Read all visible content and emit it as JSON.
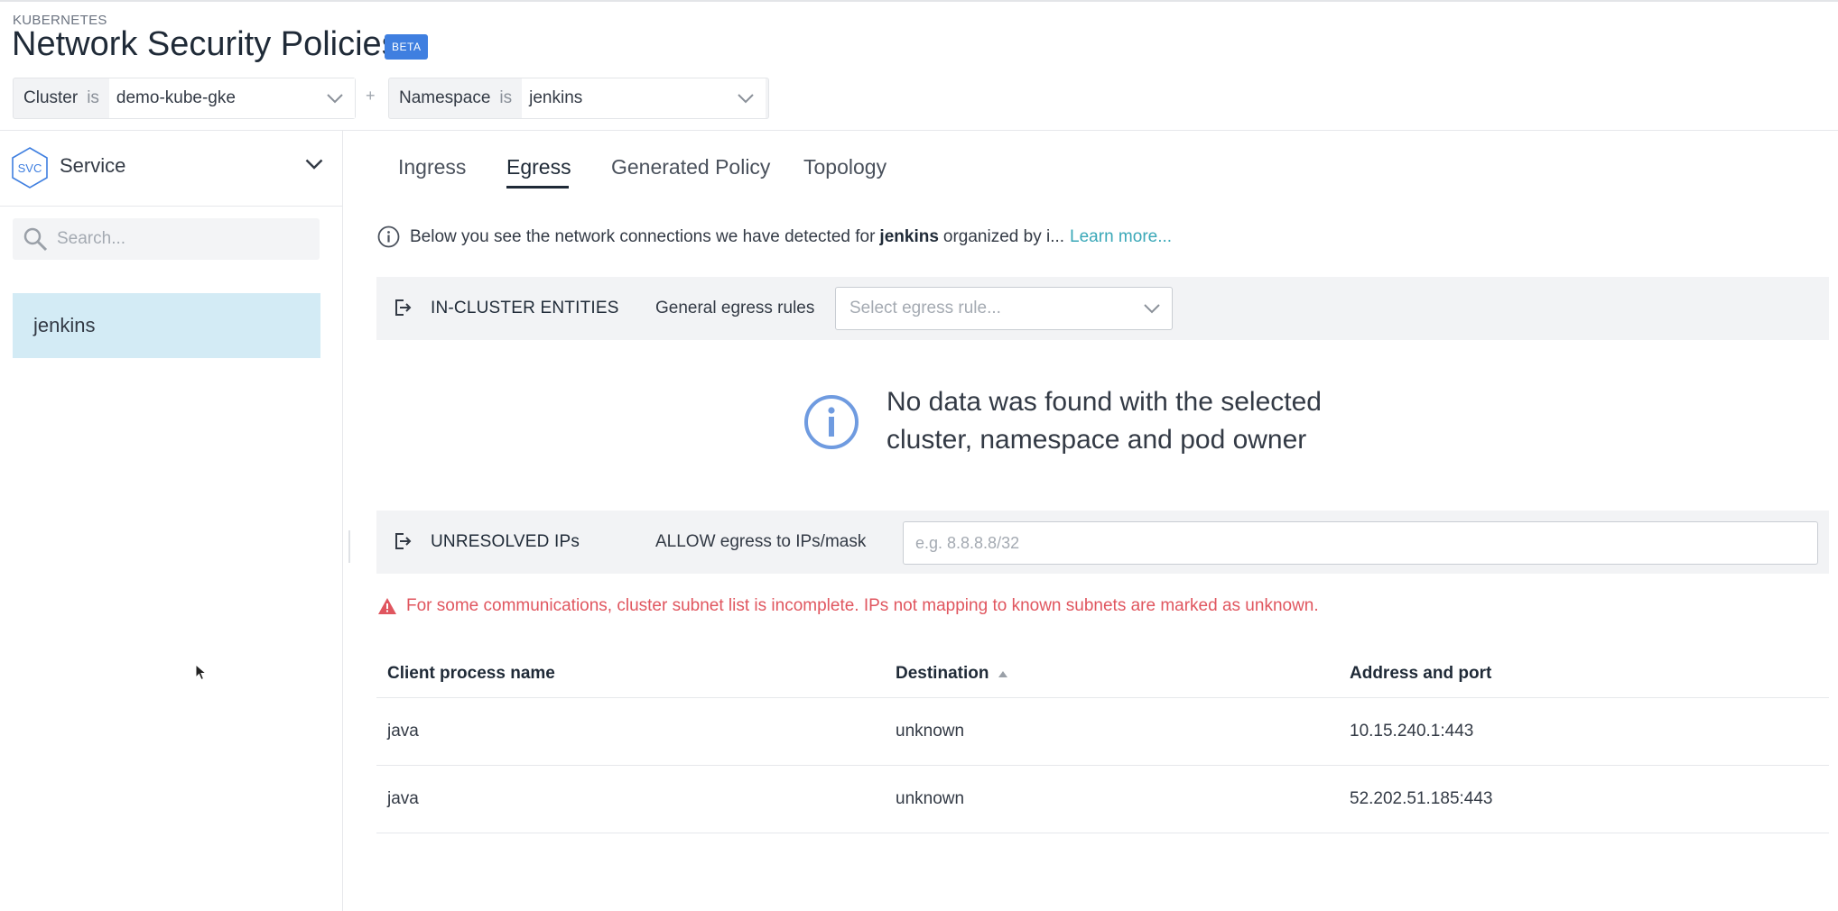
{
  "header": {
    "eyebrow": "KUBERNETES",
    "title": "Network Security Policies",
    "badge": "BETA",
    "filters": [
      {
        "label": "Cluster",
        "operator": "is",
        "value": "demo-kube-gke"
      },
      {
        "label": "Namespace",
        "operator": "is",
        "value": "jenkins"
      }
    ],
    "filter_joiner": "+"
  },
  "sidebar": {
    "type_badge": "SVC",
    "type_label": "Service",
    "search_placeholder": "Search...",
    "items": [
      {
        "label": "jenkins",
        "selected": true
      }
    ]
  },
  "tabs": [
    {
      "label": "Ingress",
      "active": false
    },
    {
      "label": "Egress",
      "active": true
    },
    {
      "label": "Generated Policy",
      "active": false
    },
    {
      "label": "Topology",
      "active": false
    }
  ],
  "info": {
    "prefix": "Below you see the network connections we have detected for",
    "entity": "jenkins",
    "suffix": "organized by i...",
    "link": "Learn more..."
  },
  "in_cluster": {
    "title": "IN-CLUSTER ENTITIES",
    "rule_label": "General egress rules",
    "select_placeholder": "Select egress rule...",
    "empty_line1": "No data was found with the selected",
    "empty_line2": "cluster, namespace and pod owner"
  },
  "unresolved": {
    "title": "UNRESOLVED IPs",
    "rule_label": "ALLOW egress to IPs/mask",
    "input_placeholder": "e.g. 8.8.8.8/32",
    "warning": "For some communications, cluster subnet list is incomplete. IPs not mapping to known subnets are marked as unknown."
  },
  "table": {
    "columns": [
      "Client process name",
      "Destination",
      "Address and port"
    ],
    "rows": [
      [
        "java",
        "unknown",
        "10.15.240.1:443"
      ],
      [
        "java",
        "unknown",
        "52.202.51.185:443"
      ]
    ]
  },
  "colors": {
    "accent": "#3f7fe0",
    "selected_bg": "#d3ebf5",
    "link": "#3aa8b8",
    "warning": "#e0565f",
    "info_icon": "#6f9be0"
  }
}
